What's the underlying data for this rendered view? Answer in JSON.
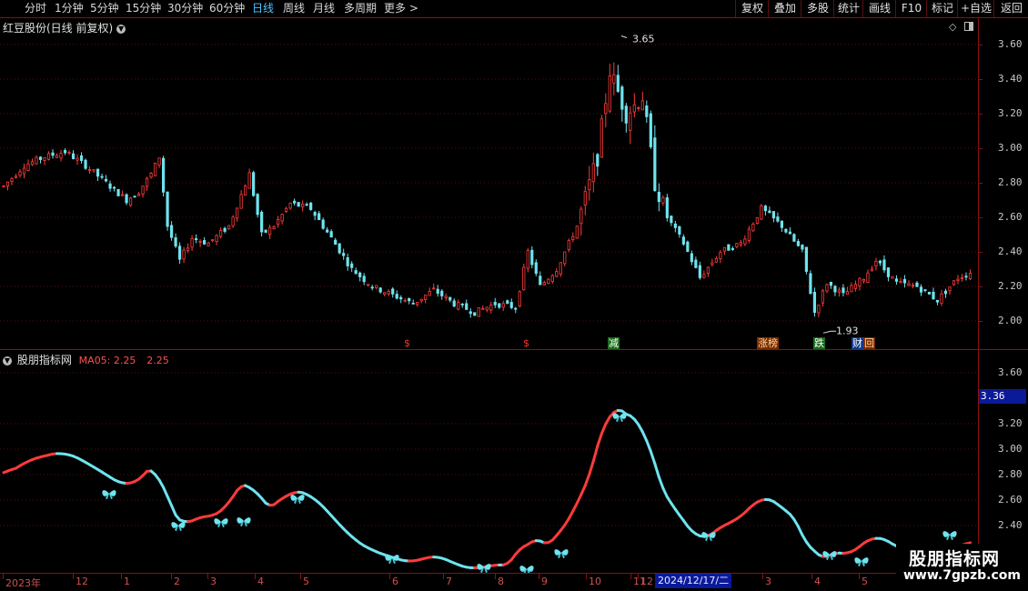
{
  "toolbar": {
    "periods": [
      {
        "label": "分时",
        "active": false
      },
      {
        "label": "1分钟",
        "active": false
      },
      {
        "label": "5分钟",
        "active": false
      },
      {
        "label": "15分钟",
        "active": false
      },
      {
        "label": "30分钟",
        "active": false
      },
      {
        "label": "60分钟",
        "active": false
      },
      {
        "label": "日线",
        "active": true
      },
      {
        "label": "周线",
        "active": false
      },
      {
        "label": "月线",
        "active": false
      },
      {
        "label": "多周期",
        "active": false
      },
      {
        "label": "更多",
        "active": false
      }
    ],
    "right_buttons": [
      "复权",
      "叠加",
      "多股",
      "统计",
      "画线",
      "F10",
      "标记",
      "+自选",
      "返回"
    ]
  },
  "main_chart": {
    "title": "红豆股份(日线 前复权)",
    "y_ticks": [
      "3.60",
      "3.40",
      "3.20",
      "3.00",
      "2.80",
      "2.60",
      "2.40",
      "2.20",
      "2.00"
    ],
    "high_label": "3.65",
    "low_label": "1.93",
    "events": [
      {
        "text": "$",
        "style": "red"
      },
      {
        "text": "$",
        "style": "red"
      },
      {
        "text": "减",
        "style": "green"
      },
      {
        "text": "涨榜",
        "style": "orange"
      },
      {
        "text": "跌",
        "style": "green"
      },
      {
        "text": "财",
        "style": "blue"
      },
      {
        "text": "回",
        "style": "orange"
      }
    ]
  },
  "indicator": {
    "name": "股朋指标网",
    "ma_label": "MA05: 2.25",
    "value_label": "2.25",
    "y_ticks": [
      "3.60",
      "3.20",
      "3.00",
      "2.80",
      "2.60",
      "2.40"
    ],
    "cursor_price": "3.36"
  },
  "date_axis": {
    "labels": [
      "2023年",
      "12",
      "1",
      "2",
      "3",
      "4",
      "5",
      "6",
      "7",
      "8",
      "9",
      "10",
      "11",
      "12",
      "1",
      "3",
      "4",
      "5"
    ],
    "cursor_date": "2024/12/17/二"
  },
  "watermark": {
    "title": "股朋指标网",
    "url": "www.7gpzb.com"
  },
  "colors": {
    "up": "#ff3b3b",
    "down": "#6fe3ee",
    "axis": "#8a1010",
    "grid": "#5a0e0e",
    "accent": "#4fc3ff"
  },
  "chart_data": {
    "type": "candlestick",
    "title": "红豆股份(日线 前复权)",
    "y_range": [
      1.9,
      3.7
    ],
    "approx_close_path": [
      [
        0,
        2.78
      ],
      [
        5,
        2.9
      ],
      [
        10,
        2.95
      ],
      [
        15,
        2.98
      ],
      [
        20,
        2.9
      ],
      [
        25,
        2.8
      ],
      [
        30,
        2.7
      ],
      [
        33,
        2.75
      ],
      [
        36,
        2.85
      ],
      [
        38,
        2.95
      ],
      [
        40,
        2.55
      ],
      [
        43,
        2.35
      ],
      [
        46,
        2.48
      ],
      [
        50,
        2.45
      ],
      [
        55,
        2.55
      ],
      [
        60,
        2.85
      ],
      [
        63,
        2.5
      ],
      [
        66,
        2.55
      ],
      [
        70,
        2.68
      ],
      [
        75,
        2.65
      ],
      [
        80,
        2.48
      ],
      [
        85,
        2.3
      ],
      [
        90,
        2.2
      ],
      [
        95,
        2.15
      ],
      [
        100,
        2.1
      ],
      [
        105,
        2.18
      ],
      [
        110,
        2.1
      ],
      [
        115,
        2.05
      ],
      [
        120,
        2.1
      ],
      [
        125,
        2.08
      ],
      [
        128,
        2.4
      ],
      [
        131,
        2.2
      ],
      [
        135,
        2.3
      ],
      [
        140,
        2.55
      ],
      [
        145,
        2.95
      ],
      [
        148,
        3.45
      ],
      [
        152,
        3.2
      ],
      [
        156,
        3.3
      ],
      [
        159,
        2.8
      ],
      [
        162,
        2.6
      ],
      [
        166,
        2.45
      ],
      [
        170,
        2.25
      ],
      [
        175,
        2.4
      ],
      [
        180,
        2.45
      ],
      [
        185,
        2.65
      ],
      [
        190,
        2.55
      ],
      [
        195,
        2.4
      ],
      [
        198,
        2.05
      ],
      [
        201,
        2.22
      ],
      [
        205,
        2.15
      ],
      [
        210,
        2.25
      ],
      [
        213,
        2.35
      ],
      [
        218,
        2.22
      ],
      [
        223,
        2.2
      ],
      [
        228,
        2.12
      ],
      [
        233,
        2.25
      ],
      [
        236,
        2.28
      ]
    ]
  }
}
